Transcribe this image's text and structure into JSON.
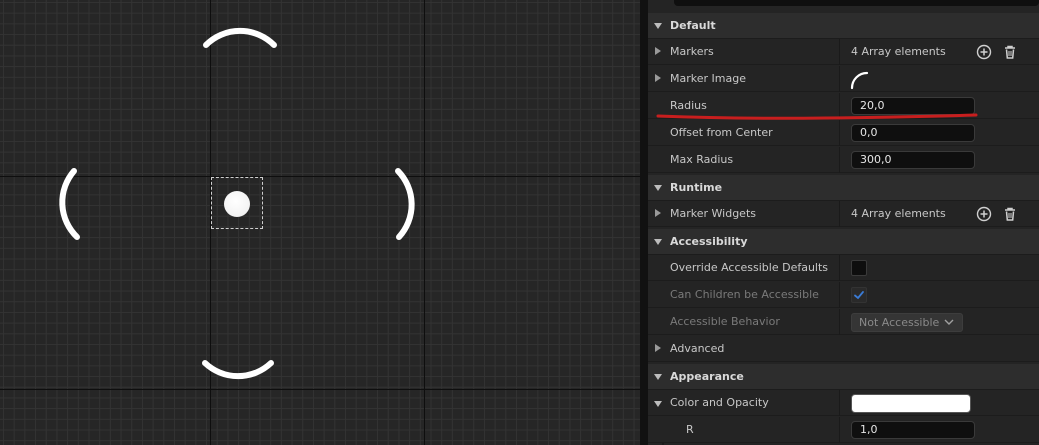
{
  "details": {
    "sections": {
      "default": "Default",
      "runtime": "Runtime",
      "accessibility": "Accessibility",
      "appearance": "Appearance"
    },
    "markers": {
      "label": "Markers",
      "value": "4 Array elements"
    },
    "marker_image": {
      "label": "Marker Image"
    },
    "radius": {
      "label": "Radius",
      "value": "20,0"
    },
    "offset_from_center": {
      "label": "Offset from Center",
      "value": "0,0"
    },
    "max_radius": {
      "label": "Max Radius",
      "value": "300,0"
    },
    "marker_widgets": {
      "label": "Marker Widgets",
      "value": "4 Array elements"
    },
    "override_accessible_defaults": {
      "label": "Override Accessible Defaults",
      "checked": false
    },
    "can_children_be_accessible": {
      "label": "Can Children be Accessible",
      "checked": true
    },
    "accessible_behavior": {
      "label": "Accessible Behavior",
      "value": "Not Accessible"
    },
    "advanced": {
      "label": "Advanced"
    },
    "color_and_opacity": {
      "label": "Color and Opacity",
      "color": "#FFFFFF"
    },
    "r": {
      "label": "R",
      "value": "1,0"
    }
  },
  "icons": [
    "add-icon",
    "trash-icon",
    "chevron-down-icon",
    "checkmark-icon",
    "arc-marker-icon"
  ],
  "colors": {
    "accent_check": "#3a7bd5",
    "annotation_line": "#c81e1e"
  }
}
